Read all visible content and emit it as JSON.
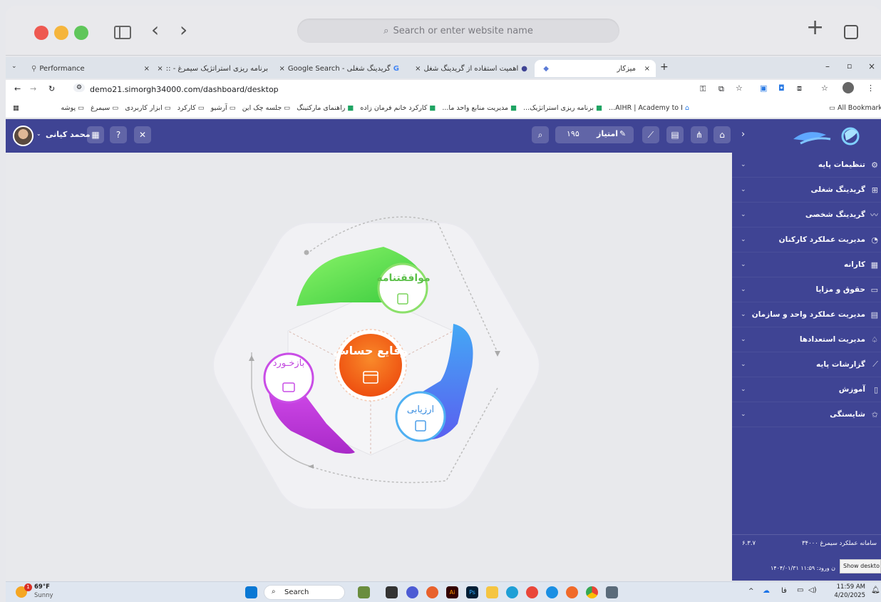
{
  "safari": {
    "search_placeholder": "Search or enter website name"
  },
  "tabs": [
    {
      "label": "Performance"
    },
    {
      "label": "برنامه ریزی استراتژیک سیمرغ - ::"
    },
    {
      "label": "گریدینگ شغلی - Google Search"
    },
    {
      "label": "اهمیت استفاده از گریدینگ شغل"
    },
    {
      "label": "میزکار"
    }
  ],
  "address": {
    "url": "demo21.simorgh34000.com/dashboard/desktop"
  },
  "bookmarks": {
    "items": [
      "AIHR | Academy to I...",
      "برنامه ریزی استراتژیک...",
      "مدیریت منابع واحد ما...",
      "کارکرد خانم فرمان زاده",
      "راهنمای مارکتینگ",
      "جلسه چک این",
      "آرشیو",
      "کارکرد",
      "ابزار کاربردی",
      "سیمرغ",
      "پوشه"
    ],
    "all": "All Bookmarks"
  },
  "header": {
    "user_name": "محمد کیانی",
    "points_label": "امتیاز",
    "points_value": "۱۹۵"
  },
  "sidebar": {
    "items": [
      {
        "label": "تنظیمات پایه",
        "icon": "⚙"
      },
      {
        "label": "گریدینگ شغلی",
        "icon": "⊞"
      },
      {
        "label": "گریدینگ شخصی",
        "icon": "〰"
      },
      {
        "label": "مدیریت عملکرد کارکنان",
        "icon": "◔"
      },
      {
        "label": "کارانه",
        "icon": "▦"
      },
      {
        "label": "حقوق و مزایا",
        "icon": "▭"
      },
      {
        "label": "مدیریت عملکرد واحد و سازمان",
        "icon": "▤"
      },
      {
        "label": "مدیریت استعدادها",
        "icon": "♤"
      },
      {
        "label": "گزارشات پایه",
        "icon": "⟋"
      },
      {
        "label": "آموزش",
        "icon": "▯"
      },
      {
        "label": "شایستگی",
        "icon": "✩"
      }
    ],
    "footer_system": "سامانه عملکرد سیمرغ ۳۴۰۰۰",
    "footer_version": "۶.۳.۷",
    "footer_login": "ن ورود: ۱۱:۵۹ ۱۴۰۴/۰۱/۳۱",
    "show_desktop": "Show deskto"
  },
  "diagram": {
    "top": "موافقتنامه",
    "center": "وقایع حساس",
    "left": "بازخـورد",
    "right": "ارزیابی"
  },
  "taskbar": {
    "weather_temp": "69°F",
    "weather_desc": "Sunny",
    "search": "Search",
    "time": "11:59 AM",
    "date": "4/20/2025",
    "lang": "فا",
    "badge": "1"
  },
  "colors": {
    "app_bar": "#3f4494",
    "green": "#4ed04a",
    "blue": "#3f7fe6",
    "magenta": "#c23ad8",
    "orange": "#f05a1a"
  }
}
